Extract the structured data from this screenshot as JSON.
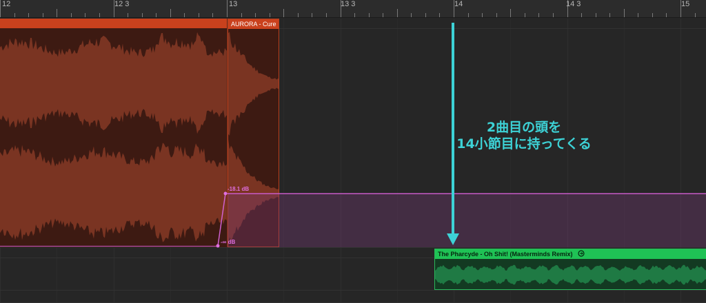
{
  "ruler": {
    "labels": [
      "12",
      "12 3",
      "13",
      "13 3",
      "14",
      "14 3",
      "15"
    ]
  },
  "regions": [
    {
      "name": "",
      "color": "#c9411d"
    },
    {
      "name": "AURORA - Cure",
      "color": "#c9411d"
    },
    {
      "name": "The Pharcyde - Oh Shit! (Masterminds Remix)",
      "icon": "loop-icon",
      "color": "#1fc255"
    }
  ],
  "automation": {
    "start_label": "-∞ dB",
    "end_label": "-18.1 dB",
    "color": "#c85ac8"
  },
  "annotation": {
    "line1": "2曲目の頭を",
    "line2": "14小節目に持ってくる",
    "color": "#3dd2d6"
  }
}
